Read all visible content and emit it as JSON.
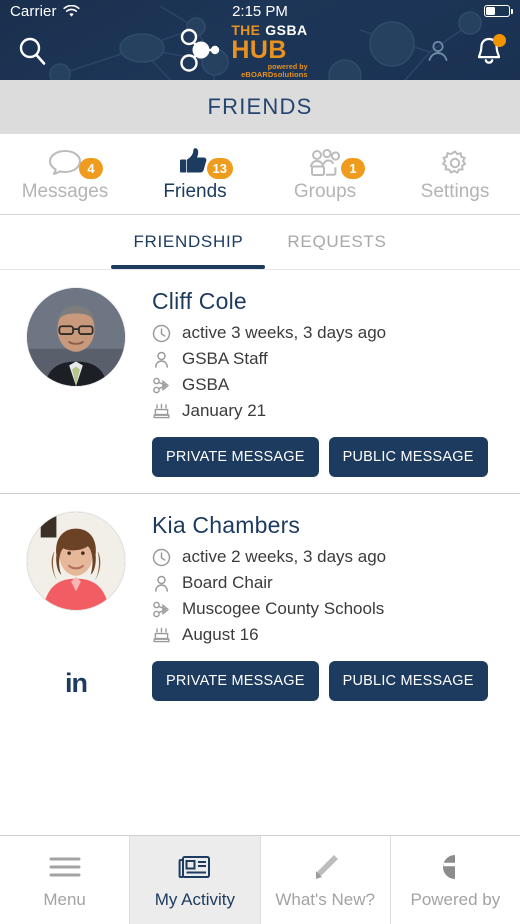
{
  "statusbar": {
    "carrier": "Carrier",
    "wifi_icon": "wifi-icon",
    "time": "2:15 PM",
    "battery_icon": "battery-icon"
  },
  "header": {
    "search_icon": "search-icon",
    "profile_icon": "profile-icon",
    "notifications_icon": "bell-icon",
    "logo": {
      "the": "THE",
      "gsba": "GSBA",
      "hub": "HUB",
      "powered_by": "powered by",
      "brand": "eBOARDsolutions"
    },
    "background_color": "#1b3151",
    "accent_color": "#e8921f"
  },
  "page_title": "FRIENDS",
  "tabs": [
    {
      "label": "Messages",
      "icon": "chat-bubble-icon",
      "badge": "4",
      "active": false
    },
    {
      "label": "Friends",
      "icon": "thumbs-up-icon",
      "badge": "13",
      "active": true
    },
    {
      "label": "Groups",
      "icon": "group-people-icon",
      "badge": "1",
      "active": false
    },
    {
      "label": "Settings",
      "icon": "gear-icon",
      "badge": "",
      "active": false
    }
  ],
  "subtabs": [
    {
      "label": "FRIENDSHIP",
      "active": true
    },
    {
      "label": "REQUESTS",
      "active": false
    }
  ],
  "friends": [
    {
      "name": "Cliff Cole",
      "last_active": "active 3 weeks, 3 days ago",
      "role": "GSBA Staff",
      "organization": "GSBA",
      "birthday": "January 21",
      "social": "",
      "buttons": {
        "private": "PRIVATE MESSAGE",
        "public": "PUBLIC MESSAGE"
      }
    },
    {
      "name": "Kia Chambers",
      "last_active": "active 2 weeks, 3 days ago",
      "role": "Board Chair",
      "organization": "Muscogee County Schools",
      "birthday": "August 16",
      "social": "in",
      "buttons": {
        "private": "PRIVATE MESSAGE",
        "public": "PUBLIC MESSAGE"
      }
    }
  ],
  "meta_icons": {
    "active": "clock-icon",
    "role": "person-icon",
    "organization": "network-share-icon",
    "birthday": "birthday-cake-icon"
  },
  "bottomnav": [
    {
      "label": "Menu",
      "icon": "hamburger-menu-icon",
      "active": false
    },
    {
      "label": "My Activity",
      "icon": "newspaper-icon",
      "active": true
    },
    {
      "label": "What's New?",
      "icon": "pencil-icon",
      "active": false
    },
    {
      "label": "Powered by",
      "icon": "eboard-logo-icon",
      "active": false
    }
  ],
  "colors": {
    "navy": "#1d3a5f",
    "orange": "#ef9b1d",
    "titlebar_gray": "#dcdcdc",
    "muted_text": "#a8a8a8"
  }
}
